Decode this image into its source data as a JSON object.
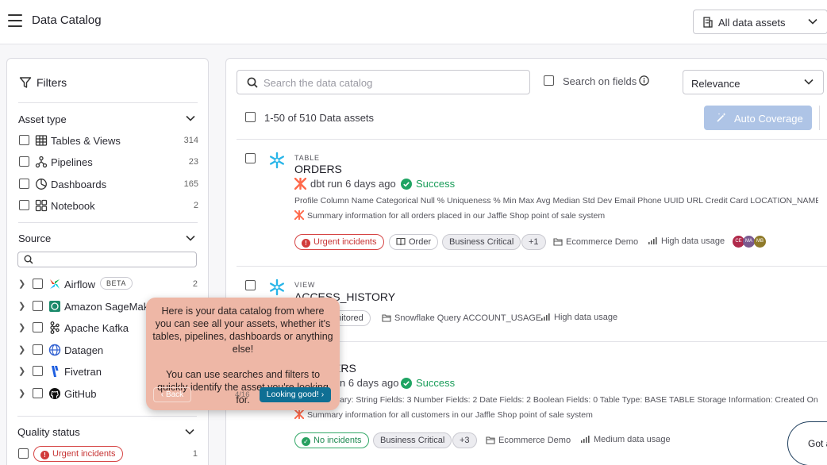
{
  "header": {
    "title": "Data Catalog",
    "asset_filter": "All data assets"
  },
  "filters": {
    "title": "Filters",
    "asset_type": {
      "title": "Asset type",
      "items": [
        {
          "label": "Tables & Views",
          "count": "314",
          "icon": "table-icon"
        },
        {
          "label": "Pipelines",
          "count": "23",
          "icon": "pipeline-icon"
        },
        {
          "label": "Dashboards",
          "count": "165",
          "icon": "dashboard-icon"
        },
        {
          "label": "Notebook",
          "count": "2",
          "icon": "notebook-icon"
        }
      ]
    },
    "source": {
      "title": "Source",
      "items": [
        {
          "label": "Airflow",
          "badge": "BETA",
          "count": "2",
          "icon": "airflow-icon"
        },
        {
          "label": "Amazon SageMaker",
          "count": "",
          "icon": "sagemaker-icon"
        },
        {
          "label": "Apache Kafka",
          "count": "",
          "icon": "kafka-icon"
        },
        {
          "label": "Datagen",
          "count": "",
          "icon": "globe-icon"
        },
        {
          "label": "Fivetran",
          "count": "",
          "icon": "fivetran-icon"
        },
        {
          "label": "GitHub",
          "count": "",
          "icon": "github-icon"
        }
      ]
    },
    "quality_status": {
      "title": "Quality status",
      "items": [
        {
          "label": "Urgent incidents",
          "count": "1"
        }
      ]
    }
  },
  "search": {
    "placeholder": "Search the data catalog",
    "search_on_fields": "Search on fields"
  },
  "sort": {
    "value": "Relevance"
  },
  "results": {
    "count_label": "1-50 of 510 Data assets",
    "auto_coverage": "Auto Coverage"
  },
  "assets": [
    {
      "type": "TABLE",
      "name": "ORDERS",
      "run": "dbt run 6 days ago",
      "status": "Success",
      "fields": "Profile Column Name Categorical Null % Uniqueness % Min Max Avg Median Std Dev Email Phone UUID URL Credit Card LOCATION_NAME ...",
      "summary": "Summary information for all orders placed in our Jaffle Shop point of sale system",
      "chips": [
        "Urgent incidents",
        "Order",
        "Business Critical",
        "+1"
      ],
      "workspace": "Ecommerce Demo",
      "usage": "High data usage",
      "avatars": [
        "CE",
        "MA",
        "MB"
      ]
    },
    {
      "type": "VIEW",
      "name": "ACCESS_HISTORY",
      "chip_partial": "onitored",
      "source": "Snowflake Query ACCOUNT_USAGE",
      "usage": "High data usage"
    },
    {
      "name_partial": "ERS",
      "run_partial": "n 6 days ago",
      "status": "Success",
      "fields_partial": "ary: String Fields: 3 Number Fields: 2 Date Fields: 2 Boolean Fields: 0 Table Type: BASE TABLE Storage Information: Created On...",
      "summary_partial": "Summary information for all customers in our Jaffle Shop point of sale system",
      "chips": [
        "No incidents",
        "Business Critical",
        "+3"
      ],
      "workspace": "Ecommerce Demo",
      "usage": "Medium data usage"
    }
  ],
  "tour": {
    "message_1": "Here is your data catalog from where you can see all your assets, whether it's tables, pipelines, dashboards or anything else!",
    "message_2": "You can use searches and filters to quickly identify the asset you're looking for.",
    "back": "Back",
    "step": "4/16",
    "next": "Looking good!"
  },
  "floating": {
    "label": "Got a"
  }
}
